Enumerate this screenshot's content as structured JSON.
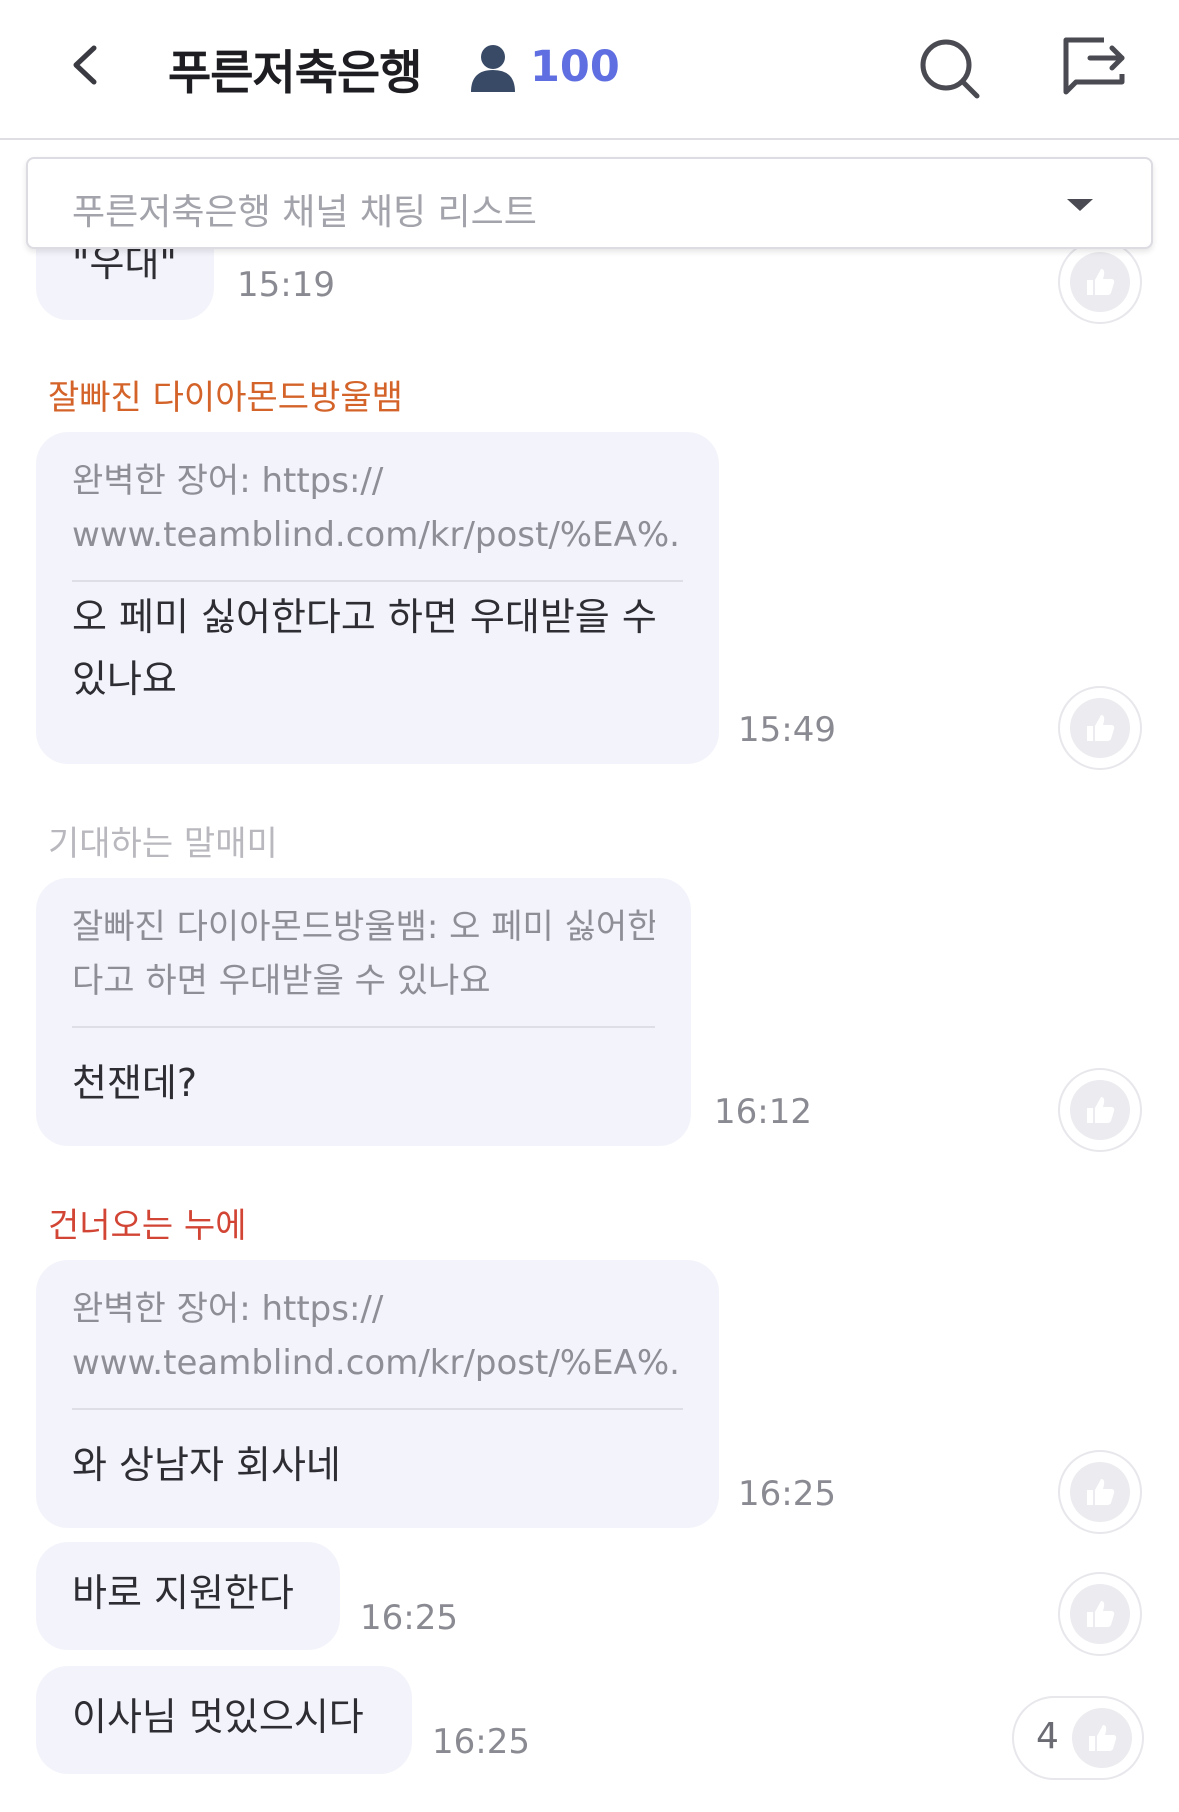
{
  "header": {
    "title": "푸른저축은행",
    "member_count": "100"
  },
  "channel_select": {
    "placeholder": "푸른저축은행 채널 채팅 리스트"
  },
  "messages": [
    {
      "text": "\"우대\"",
      "time": "15:19"
    },
    {
      "author": "잘빠진 다이아몬드방울뱀",
      "author_color": "#d4632a",
      "quote": [
        "완벽한 장어: https://",
        "www.teamblind.com/kr/post/%EA%..."
      ],
      "text": [
        "오 페미 싫어한다고 하면 우대받을 수",
        "있나요"
      ],
      "time": "15:49"
    },
    {
      "author": "기대하는 말매미",
      "author_color": "#b8b8be",
      "quote": [
        "잘빠진 다이아몬드방울뱀: 오 페미 싫어한",
        "다고 하면 우대받을 수 있나요"
      ],
      "text": "천잰데?",
      "time": "16:12"
    },
    {
      "author": "건너오는 누에",
      "author_color": "#d24535",
      "quote": [
        "완벽한 장어: https://",
        "www.teamblind.com/kr/post/%EA%..."
      ],
      "text": "와 상남자 회사네",
      "time": "16:25"
    },
    {
      "text": "바로 지원한다",
      "time": "16:25"
    },
    {
      "text": "이사님 멋있으시다",
      "time": "16:25",
      "like_count": "4"
    }
  ],
  "icons": [
    "chevron-left-icon",
    "user-icon",
    "search-icon",
    "share-icon",
    "caret-down-icon",
    "thumbs-up-icon"
  ],
  "colors": {
    "accent": "#5f6ee0",
    "bubble": "#f3f3fb"
  }
}
